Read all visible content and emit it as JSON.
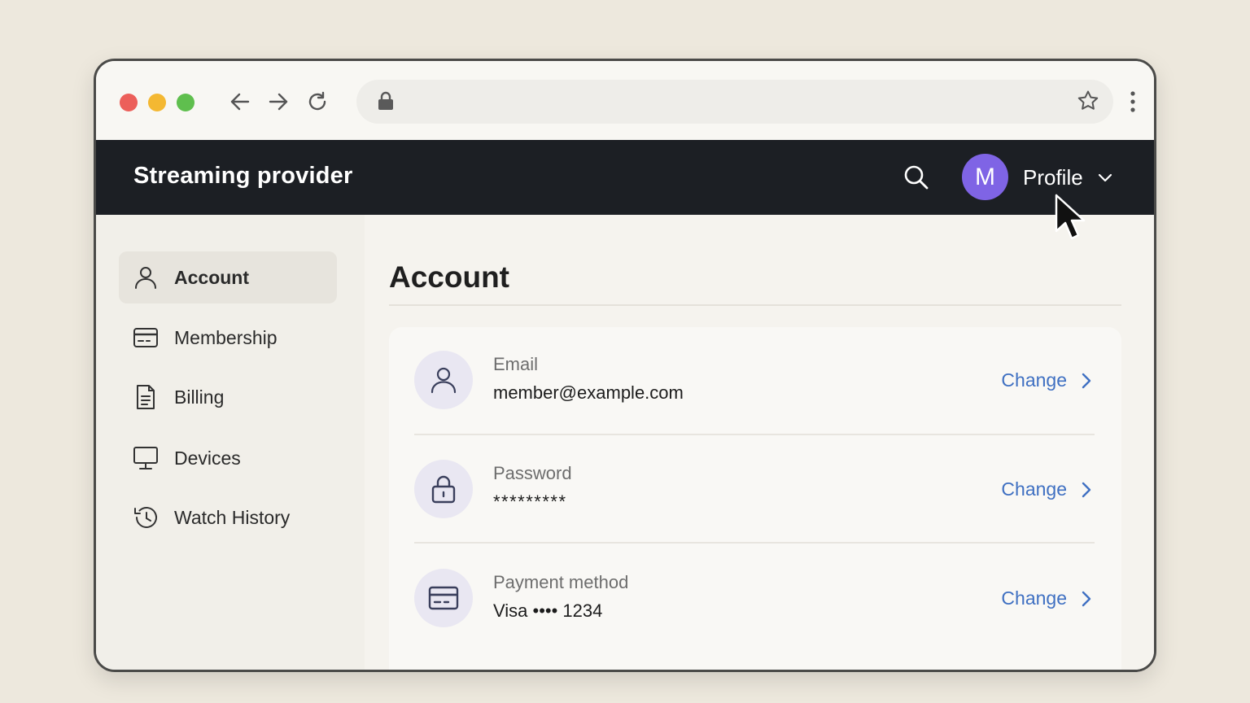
{
  "browser": {
    "traffic_lights": {
      "close": "#ec5f5a",
      "minimize": "#f4b832",
      "zoom": "#5fbf4e"
    },
    "icons": [
      "back-arrow-icon",
      "forward-arrow-icon",
      "reload-icon",
      "lock-icon",
      "star-icon",
      "kebab-menu-icon"
    ]
  },
  "header": {
    "brand": "Streaming provider",
    "avatar_initial": "M",
    "profile_label": "Profile",
    "avatar_color": "#7f64e5",
    "background": "#1c1f24"
  },
  "sidebar": {
    "items": [
      {
        "label": "Account",
        "icon": "user-icon",
        "active": true
      },
      {
        "label": "Membership",
        "icon": "card-icon",
        "active": false
      },
      {
        "label": "Billing",
        "icon": "document-icon",
        "active": false
      },
      {
        "label": "Devices",
        "icon": "monitor-icon",
        "active": false
      },
      {
        "label": "Watch History",
        "icon": "history-icon",
        "active": false
      }
    ]
  },
  "main": {
    "title": "Account",
    "rows": [
      {
        "label": "Email",
        "value": "member@example.com",
        "action": "Change",
        "icon": "user-icon"
      },
      {
        "label": "Password",
        "value": "*********",
        "action": "Change",
        "icon": "lock-icon"
      },
      {
        "label": "Payment method",
        "value": "Visa •••• 1234",
        "action": "Change",
        "icon": "card-icon"
      }
    ],
    "link_color": "#3f70c2"
  }
}
